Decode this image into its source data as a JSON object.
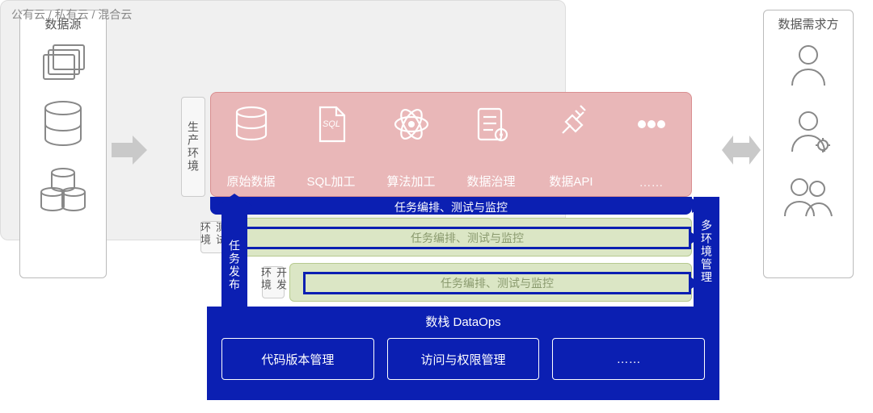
{
  "left_panel": {
    "title": "数据源"
  },
  "right_panel": {
    "title": "数据需求方"
  },
  "cloud_title": "公有云 / 私有云 / 混合云",
  "envs": {
    "prod": {
      "label": "生产环境",
      "orchestration": "任务编排、测试与监控"
    },
    "test": {
      "label": "测试环境",
      "orchestration": "任务编排、测试与监控"
    },
    "dev": {
      "label": "开发环境",
      "orchestration": "任务编排、测试与监控"
    }
  },
  "stages": {
    "raw": {
      "label": "原始数据"
    },
    "sql": {
      "label": "SQL加工",
      "icon_text": "SQL"
    },
    "algo": {
      "label": "算法加工"
    },
    "gov": {
      "label": "数据治理"
    },
    "api": {
      "label": "数据API"
    },
    "more": {
      "label": "……"
    }
  },
  "publish_label": "任务发布",
  "multi_env_label": "多环境管理",
  "dataops": {
    "title": "数栈 DataOps",
    "boxes": {
      "code": "代码版本管理",
      "access": "访问与权限管理",
      "more": "……"
    }
  }
}
